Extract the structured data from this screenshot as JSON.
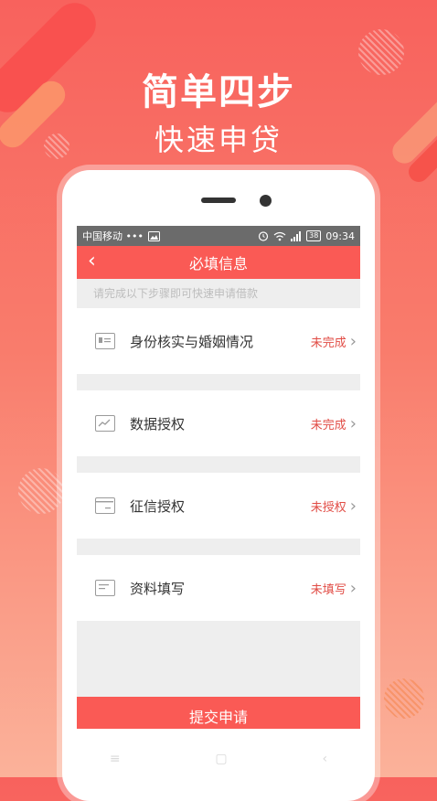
{
  "promo": {
    "headline": "简单四步",
    "subheadline": "快速申贷"
  },
  "status_bar": {
    "carrier": "中国移动 •••",
    "time": "09:34",
    "battery": "38"
  },
  "header": {
    "title": "必填信息",
    "back_icon": "chevron-left-icon"
  },
  "hint": "请完成以下步骤即可快速申请借款",
  "items": [
    {
      "label": "身份核实与婚姻情况",
      "status": "未完成",
      "icon": "id-card-icon"
    },
    {
      "label": "数据授权",
      "status": "未完成",
      "icon": "chart-icon"
    },
    {
      "label": "征信授权",
      "status": "未授权",
      "icon": "bank-card-icon"
    },
    {
      "label": "资料填写",
      "status": "未填写",
      "icon": "form-icon"
    }
  ],
  "submit_label": "提交申请",
  "colors": {
    "accent": "#fa5a55",
    "status_text": "#e14c45",
    "background_top": "#f8625d",
    "background_bottom": "#fbb29a"
  }
}
